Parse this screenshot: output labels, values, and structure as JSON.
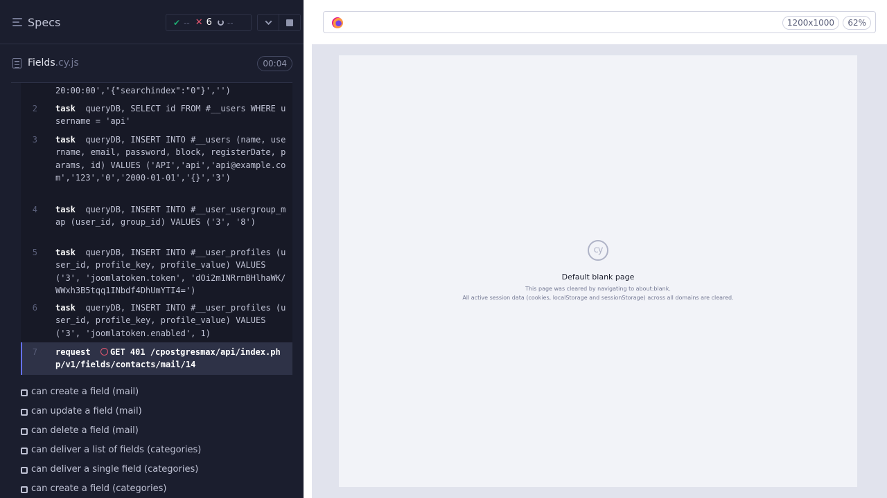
{
  "reporter": {
    "title": "Specs",
    "stats": {
      "passed": "--",
      "failed": "6",
      "pending": "--"
    },
    "file": {
      "name": "Fields",
      "ext": ".cy.js",
      "duration": "00:04"
    },
    "commands": [
      {
        "num": "",
        "name": "",
        "message": "20:00:00','{\"searchindex\":\"0\"}','')"
      },
      {
        "num": "2",
        "name": "task",
        "message": "queryDB, SELECT id FROM #__users WHERE username = 'api'"
      },
      {
        "num": "3",
        "name": "task",
        "message": "queryDB, INSERT INTO #__users (name, username, email, password, block, registerDate, params, id) VALUES ('API','api','api@example.com','123','0','2000-01-01','{}','3')"
      },
      {
        "num": "4",
        "name": "task",
        "message": "queryDB, INSERT INTO #__user_usergroup_map (user_id, group_id) VALUES ('3', '8')"
      },
      {
        "num": "5",
        "name": "task",
        "message": "queryDB, INSERT INTO #__user_profiles (user_id, profile_key, profile_value) VALUES ('3', 'joomlatoken.token', 'dOi2m1NRrnBHlhaWK/WWxh3B5tqq1INbdf4DhUmYTI4=')"
      },
      {
        "num": "6",
        "name": "task",
        "message": "queryDB, INSERT INTO #__user_profiles (user_id, profile_key, profile_value) VALUES ('3', 'joomlatoken.enabled', 1)"
      },
      {
        "num": "7",
        "name": "request",
        "message": "GET 401 /cpostgresmax/api/index.php/v1/fields/contacts/mail/14"
      }
    ],
    "tests": [
      "can create a field (mail)",
      "can update a field (mail)",
      "can delete a field (mail)",
      "can deliver a list of fields (categories)",
      "can deliver a single field (categories)",
      "can create a field (categories)"
    ]
  },
  "preview": {
    "viewport": "1200x1000",
    "zoom": "62%",
    "logo_text": "cy",
    "blank_title": "Default blank page",
    "blank_line1": "This page was cleared by navigating to about:blank.",
    "blank_line2": "All active session data (cookies, localStorage and sessionStorage) across all domains are cleared."
  },
  "colors": {
    "accent": "#6470f3",
    "pass": "#1fa971",
    "fail": "#e45770",
    "reporter_bg": "#1b1e2e"
  }
}
